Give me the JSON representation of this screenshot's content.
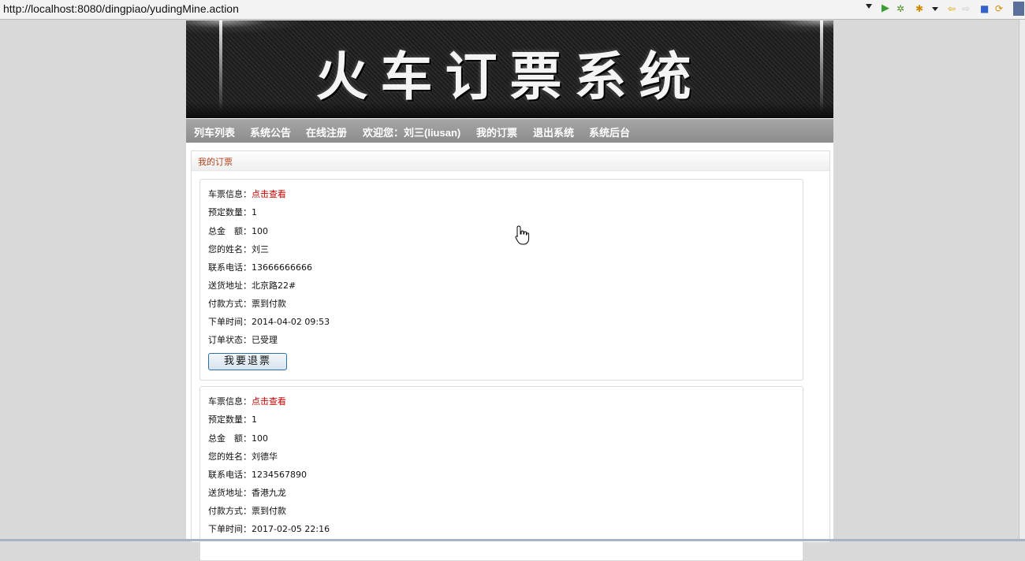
{
  "browser": {
    "url": "http://localhost:8080/dingpiao/yudingMine.action"
  },
  "site": {
    "banner_title": "火车订票系统",
    "nav": [
      "列车列表",
      "系统公告",
      "在线注册",
      "欢迎您：刘三(liusan)",
      "我的订票",
      "退出系统",
      "系统后台"
    ]
  },
  "panel": {
    "title": "我的订票"
  },
  "orders": [
    {
      "ticket_info_label": "车票信息：",
      "ticket_info_link": "点击查看",
      "quantity_label": "预定数量：",
      "quantity": "1",
      "total_label": "总金　额：",
      "total": "100",
      "name_label": "您的姓名：",
      "name": "刘三",
      "phone_label": "联系电话：",
      "phone": "13666666666",
      "address_label": "送货地址：",
      "address": "北京路22#",
      "payment_label": "付款方式：",
      "payment": "票到付款",
      "time_label": "下单时间：",
      "time": "2014-04-02 09:53",
      "status_label": "订单状态：",
      "status": "已受理",
      "refund_button": "我要退票"
    },
    {
      "ticket_info_label": "车票信息：",
      "ticket_info_link": "点击查看",
      "quantity_label": "预定数量：",
      "quantity": "1",
      "total_label": "总金　额：",
      "total": "100",
      "name_label": "您的姓名：",
      "name": "刘德华",
      "phone_label": "联系电话：",
      "phone": "1234567890",
      "address_label": "送货地址：",
      "address": "香港九龙",
      "payment_label": "付款方式：",
      "payment": "票到付款",
      "time_label": "下单时间：",
      "time": "2017-02-05 22:16"
    }
  ]
}
